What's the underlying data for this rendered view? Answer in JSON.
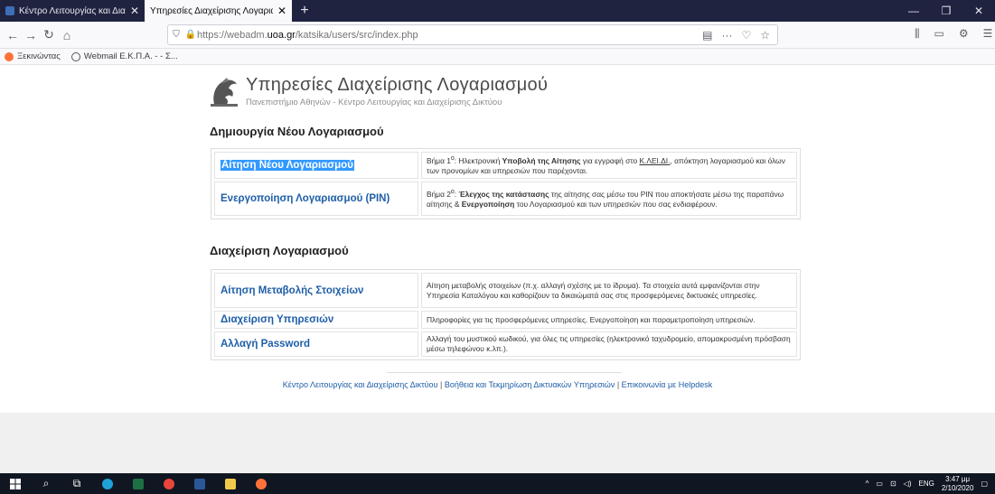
{
  "browser": {
    "tabs": [
      {
        "title": "Κέντρο Λειτουργίας και Διαχεί",
        "active": false
      },
      {
        "title": "Υπηρεσίες Διαχείρισης Λογαριασμ",
        "active": true
      }
    ],
    "url_prefix": "https://webadm.",
    "url_domain": "uoa.gr",
    "url_path": "/katsika/users/src/index.php",
    "bookmarks": [
      "Ξεκινώντας",
      "Webmail Ε.Κ.Π.Α. - - Σ..."
    ]
  },
  "header": {
    "title": "Υπηρεσίες Διαχείρισης Λογαριασμού",
    "subtitle": "Πανεπιστήμιο Αθηνών - Κέντρο Λειτουργίας και Διαχείρισης Δικτύου"
  },
  "new_account": {
    "title": "Δημιουργία Νέου Λογαριασμού",
    "rows": [
      {
        "link": "Αίτηση Νέου Λογαριασμού",
        "step": "Βήμα 1",
        "sup": "ο",
        "pre": ": Ηλεκτρονική ",
        "bold1": "Υποβολή της Αίτησης",
        "mid1": " για εγγραφή στο ",
        "under": "Κ.ΛΕΙ.ΔΙ.",
        "post": ", απόκτηση λογαριασμού και όλων των προνομίων και υπηρεσιών που παρέχονται."
      },
      {
        "link": "Ενεργοποίηση Λογαριασμού (PIN)",
        "step": "Βήμα 2",
        "sup": "ο",
        "pre": ": ",
        "bold1": "Έλεγχος της κατάστασης",
        "mid1": " της αίτησης σας μέσω του PIN που αποκτήσατε μέσω της παραπάνω αίτησης & ",
        "bold2": "Ενεργοποίηση",
        "post": " του Λογαριασμού και των υπηρεσιών που σας ενδιαφέρουν."
      }
    ]
  },
  "manage_account": {
    "title": "Διαχείριση Λογαριασμού",
    "rows": [
      {
        "link": "Αίτηση Μεταβολής Στοιχείων",
        "desc": "Αίτηση μεταβολής στοιχείων (π.χ. αλλαγή σχέσης με το ίδρυμα). Τα στοιχεία αυτά εμφανίζονται στην Υπηρεσία Καταλόγου και καθορίζουν τα δικαιώματά σας στις προσφερόμενες δικτυακές υπηρεσίες."
      },
      {
        "link": "Διαχείριση Υπηρεσιών",
        "desc": "Πληροφορίες για τις προσφερόμενες υπηρεσίες. Ενεργοποίηση και παραμετροποίηση υπηρεσιών."
      },
      {
        "link": "Αλλαγή Password",
        "desc": "Αλλαγή του μυστικού κωδικού, για όλες τις υπηρεσίες (ηλεκτρονικό ταχυδρομείο, απομακρυσμένη πρόσβαση μέσω τηλεφώνου κ.λπ.)."
      }
    ]
  },
  "footer": {
    "links": [
      "Κέντρο Λειτουργίας και Διαχείρισης Δικτύου",
      "Βοήθεια και Τεκμηρίωση Δικτυακών Υπηρεσιών",
      "Επικοινωνία με Helpdesk"
    ],
    "separator": " | "
  },
  "taskbar": {
    "language": "ENG",
    "time": "3:47 μμ",
    "date": "2/10/2020"
  },
  "colors": {
    "link": "#1f5ea8",
    "selection": "#3399ff",
    "tabbar": "#202340",
    "taskbar": "#101722"
  }
}
